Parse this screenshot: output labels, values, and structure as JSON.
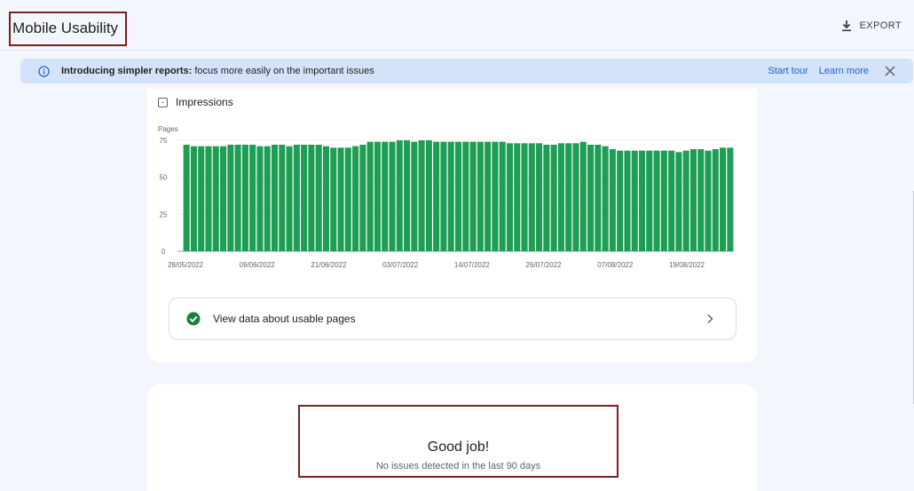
{
  "header": {
    "title": "Mobile Usability",
    "export_label": "EXPORT",
    "export_icon": "download-icon"
  },
  "banner": {
    "bold_text": "Introducing simpler reports:",
    "text": " focus more easily on the important issues",
    "start_tour": "Start tour",
    "learn_more": "Learn more",
    "icons": [
      "info-icon",
      "close-icon"
    ],
    "background": "#d5e3fa",
    "link_color": "#1a62c7"
  },
  "impressions": {
    "label": "Impressions",
    "checked": false
  },
  "chart_data": {
    "type": "bar",
    "ylabel": "Pages",
    "ylim": [
      0,
      75
    ],
    "yticks": [
      "75",
      "50",
      "25",
      "0"
    ],
    "xticks": [
      "28/05/2022",
      "09/06/2022",
      "21/06/2022",
      "03/07/2022",
      "14/07/2022",
      "26/07/2022",
      "07/08/2022",
      "19/08/2022"
    ],
    "grid": true,
    "color": "#1e9e54",
    "values": [
      72,
      71,
      71,
      71,
      71,
      71,
      72,
      72,
      72,
      72,
      71,
      71,
      72,
      72,
      71,
      72,
      72,
      72,
      72,
      71,
      70,
      70,
      70,
      71,
      72,
      74,
      74,
      74,
      74,
      75,
      75,
      74,
      75,
      75,
      74,
      74,
      74,
      74,
      74,
      74,
      74,
      74,
      74,
      74,
      73,
      73,
      73,
      73,
      73,
      72,
      72,
      73,
      73,
      73,
      74,
      72,
      72,
      71,
      69,
      68,
      68,
      68,
      68,
      68,
      68,
      68,
      68,
      67,
      68,
      69,
      69,
      68,
      69,
      70,
      70
    ]
  },
  "usable_link": {
    "label": "View data about usable pages",
    "status_color": "#188038"
  },
  "good_job": {
    "title": "Good job!",
    "subtitle": "No issues detected in the last 90 days"
  }
}
